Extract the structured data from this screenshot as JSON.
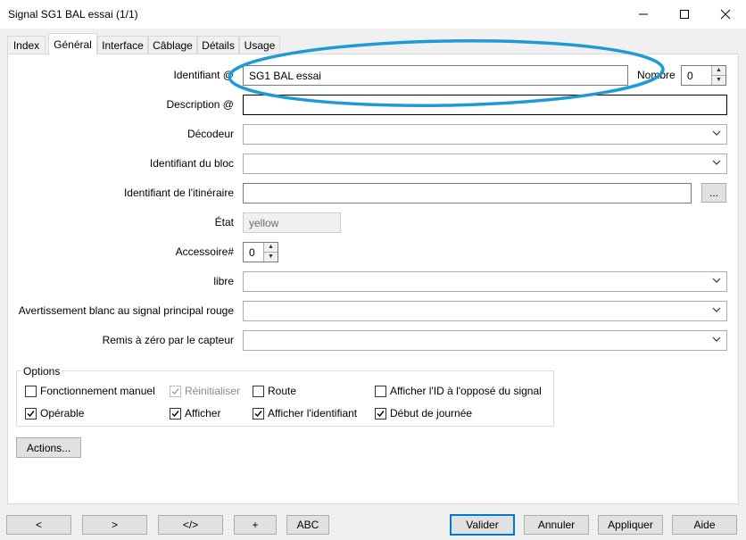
{
  "window": {
    "title": "Signal SG1 BAL essai (1/1)"
  },
  "tabs": [
    {
      "label": "Index"
    },
    {
      "label": "Général"
    },
    {
      "label": "Interface"
    },
    {
      "label": "Câblage"
    },
    {
      "label": "Détails"
    },
    {
      "label": "Usage"
    }
  ],
  "form": {
    "identifiant": {
      "label": "Identifiant @",
      "value": "SG1 BAL essai"
    },
    "nombre": {
      "label": "Nombre",
      "value": "0"
    },
    "description": {
      "label": "Description @",
      "value": ""
    },
    "decodeur": {
      "label": "Décodeur",
      "value": ""
    },
    "bloc": {
      "label": "Identifiant du bloc",
      "value": ""
    },
    "itineraire": {
      "label": "Identifiant de l'itinéraire",
      "value": "",
      "button": "..."
    },
    "etat": {
      "label": "État",
      "value": "yellow"
    },
    "accessoire": {
      "label": "Accessoire#",
      "value": "0"
    },
    "libre": {
      "label": "libre",
      "value": ""
    },
    "avertissement": {
      "label": "Avertissement blanc au signal principal rouge",
      "value": ""
    },
    "remise": {
      "label": "Remis à zéro par le capteur",
      "value": ""
    }
  },
  "options": {
    "legend": "Options",
    "items": [
      {
        "label": "Fonctionnement manuel",
        "checked": false,
        "enabled": true
      },
      {
        "label": "Réinitialiser",
        "checked": true,
        "enabled": false
      },
      {
        "label": "Route",
        "checked": false,
        "enabled": true
      },
      {
        "label": "Afficher l'ID à l'opposé du signal",
        "checked": false,
        "enabled": true
      },
      {
        "label": "Opérable",
        "checked": true,
        "enabled": true
      },
      {
        "label": "Afficher",
        "checked": true,
        "enabled": true
      },
      {
        "label": "Afficher l'identifiant",
        "checked": true,
        "enabled": true
      },
      {
        "label": "Début de journée",
        "checked": true,
        "enabled": true
      }
    ]
  },
  "actions_label": "Actions...",
  "bottom": {
    "prev": "<",
    "next": ">",
    "code": "</>",
    "add": "+",
    "abc": "ABC",
    "valider": "Valider",
    "annuler": "Annuler",
    "appliquer": "Appliquer",
    "aide": "Aide"
  },
  "colors": {
    "accent": "#0078d7",
    "annotation": "#1e9ad6"
  }
}
